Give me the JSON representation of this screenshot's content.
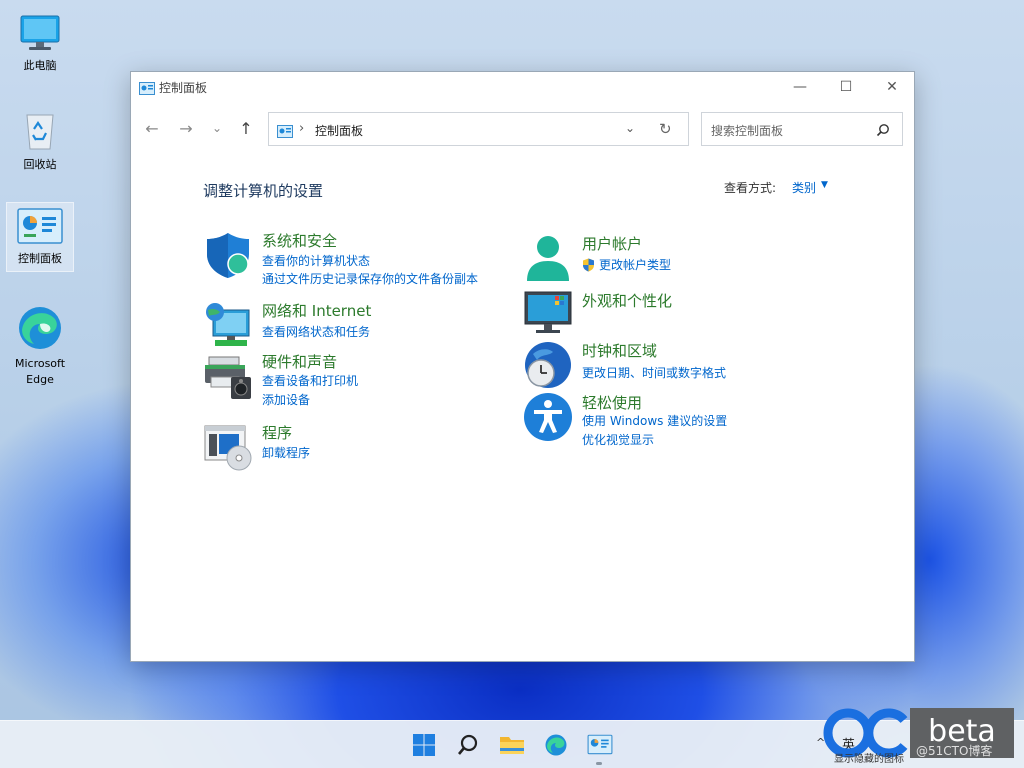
{
  "desktop": {
    "icons": [
      {
        "label": "此电脑"
      },
      {
        "label": "回收站"
      },
      {
        "label": "控制面板"
      },
      {
        "label": "Microsoft\nEdge"
      }
    ]
  },
  "window": {
    "title": "控制面板",
    "minimize": "—",
    "maximize": "☐",
    "close": "✕"
  },
  "nav": {
    "back": "←",
    "forward": "→",
    "recent": "⌄",
    "up": "↑",
    "address_sep": "›",
    "address_text": "控制面板",
    "address_dropdown": "⌄",
    "refresh": "↻",
    "search_placeholder": "搜索控制面板"
  },
  "content": {
    "title": "调整计算机的设置",
    "view_by_label": "查看方式:",
    "view_by_value": "类别",
    "view_by_caret": "▼",
    "left_categories": [
      {
        "title": "系统和安全",
        "links": [
          "查看你的计算机状态",
          "通过文件历史记录保存你的文件备份副本"
        ],
        "icon": "shield-icon"
      },
      {
        "title": "网络和 Internet",
        "links": [
          "查看网络状态和任务"
        ],
        "icon": "network-globe-icon"
      },
      {
        "title": "硬件和声音",
        "links": [
          "查看设备和打印机",
          "添加设备"
        ],
        "icon": "printer-speaker-icon"
      },
      {
        "title": "程序",
        "links": [
          "卸载程序"
        ],
        "icon": "programs-disc-icon"
      }
    ],
    "right_categories": [
      {
        "title": "用户帐户",
        "links": [
          "更改帐户类型"
        ],
        "icon": "user-icon"
      },
      {
        "title": "外观和个性化",
        "links": [],
        "icon": "monitor-icon"
      },
      {
        "title": "时钟和区域",
        "links": [
          "更改日期、时间或数字格式"
        ],
        "icon": "clock-globe-icon"
      },
      {
        "title": "轻松使用",
        "links": [
          "使用 Windows 建议的设置",
          "优化视觉显示"
        ],
        "icon": "accessibility-icon"
      }
    ]
  },
  "taskbar": {
    "tray_caret": "^",
    "ime": "英"
  },
  "watermark": {
    "brand": "beta",
    "small_text": "显示隐藏的图标",
    "blog": "@51CTO博客"
  },
  "colors": {
    "link": "#0066cc",
    "category_title": "#2c7a2c",
    "taskbar": "#e8eef6"
  }
}
